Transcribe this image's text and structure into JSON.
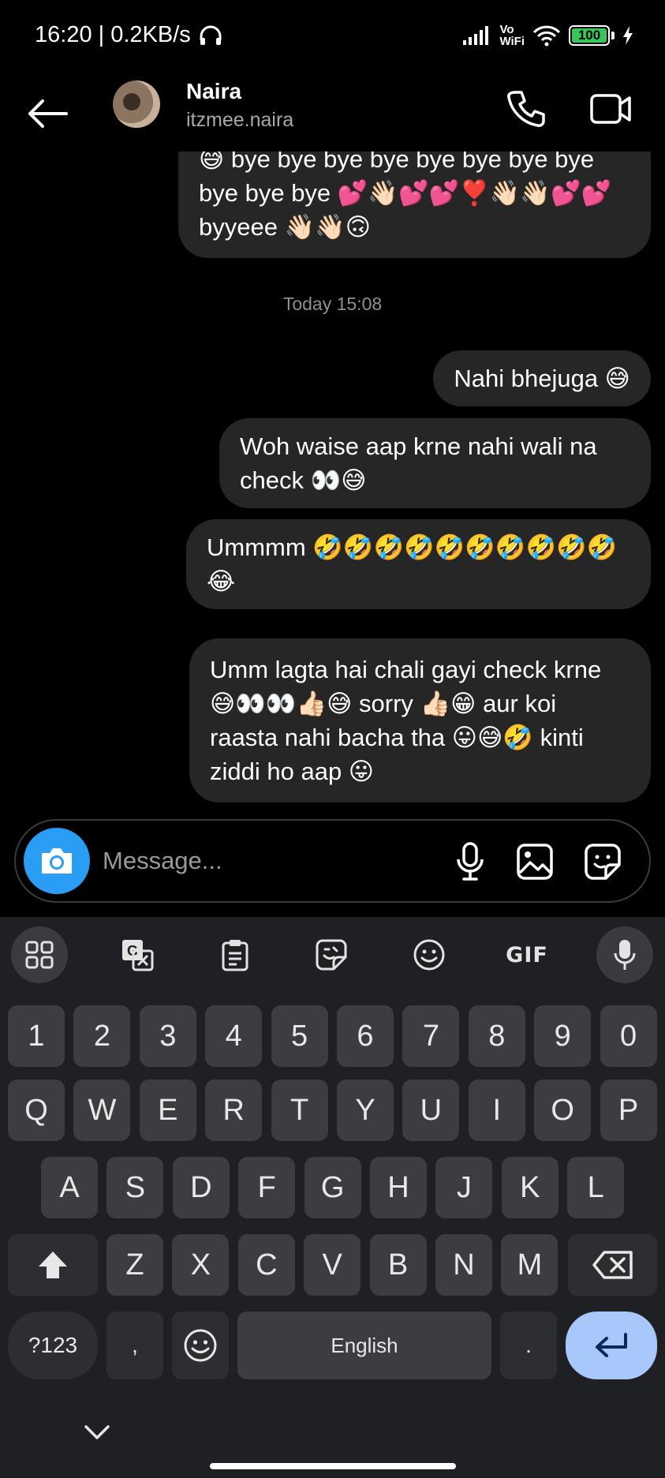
{
  "status_bar": {
    "time_speed": "16:20 | 0.2KB/s",
    "vowifi": "Vo\nWiFi",
    "battery": "100"
  },
  "header": {
    "name": "Naira",
    "username": "itzmee.naira"
  },
  "chat": {
    "timestamp": "Today 15:08",
    "messages": [
      {
        "text": "😅 bye bye bye bye bye bye bye bye bye bye bye 💕👋🏻💕💕❣️👋🏻👋🏻💕💕 byyeee 👋🏻👋🏻🙃"
      },
      {
        "text": "Nahi bhejuga 😅"
      },
      {
        "text": "Woh waise aap krne nahi wali na check 👀😅"
      },
      {
        "text": "Ummmm 🤣🤣🤣🤣🤣🤣🤣🤣🤣🤣😂"
      },
      {
        "text": "Umm lagta hai chali gayi check krne 😅👀👀👍🏻😅 sorry 👍🏻😁 aur koi raasta nahi bacha tha 😛😅🤣 kinti ziddi ho aap 😛"
      }
    ]
  },
  "composer": {
    "placeholder": "Message..."
  },
  "keyboard": {
    "toolbar": {
      "gif_label": "GIF"
    },
    "row_numbers": [
      "1",
      "2",
      "3",
      "4",
      "5",
      "6",
      "7",
      "8",
      "9",
      "0"
    ],
    "row_q": [
      "Q",
      "W",
      "E",
      "R",
      "T",
      "Y",
      "U",
      "I",
      "O",
      "P"
    ],
    "row_a": [
      "A",
      "S",
      "D",
      "F",
      "G",
      "H",
      "J",
      "K",
      "L"
    ],
    "row_z": [
      "Z",
      "X",
      "C",
      "V",
      "B",
      "N",
      "M"
    ],
    "symbols_label": "?123",
    "comma": ",",
    "space_label": "English",
    "period": "."
  },
  "colors": {
    "background": "#000000",
    "bubble": "#262626",
    "camera_button": "#2a9df4",
    "keyboard_bg": "#1f2023",
    "key_bg": "#3c3d40",
    "enter_key": "#a8c7fa",
    "battery": "#35c759"
  }
}
